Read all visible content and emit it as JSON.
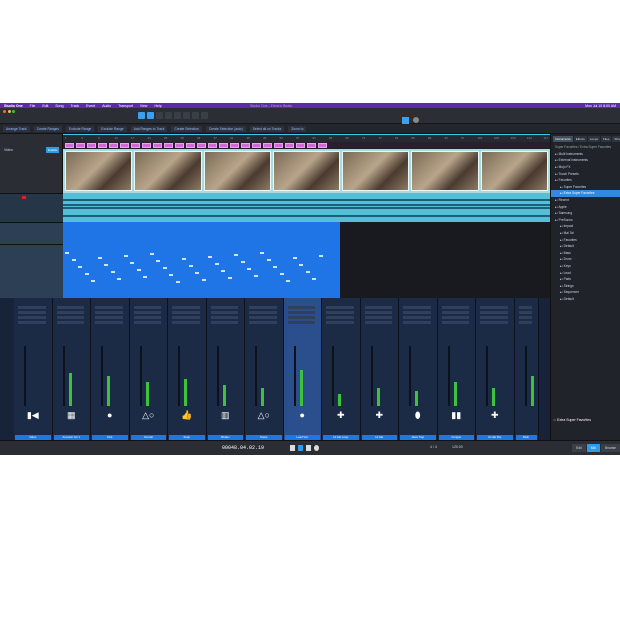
{
  "menubar": {
    "items": [
      "Studio One",
      "File",
      "Edit",
      "Song",
      "Track",
      "Event",
      "Audio",
      "Transport",
      "View",
      "Help"
    ],
    "clock": "Mon Jul 10 8:00 AM"
  },
  "window": {
    "title": "Studio One - Electric Beats"
  },
  "colors": {
    "accent": "#3aa0f0",
    "menubar": "#5a2ca8",
    "marker": "#d36ad3",
    "audio_event": "#55bfd8",
    "instrument_event": "#1f74e6",
    "meter": "#3ec23e"
  },
  "subbar": {
    "buttons": [
      "Arrange Track",
      "Create Ranges",
      "Exclude Range",
      "Exclude Range",
      "Add Ranges to Track",
      "Create Selection",
      "Create Selection (auto)",
      "Select all on Tracks",
      "Zoom to"
    ]
  },
  "track_header": {
    "video_label": "Video",
    "enable": "Enable"
  },
  "ruler": {
    "ticks": [
      "1",
      "5",
      "9",
      "13",
      "17",
      "21",
      "25",
      "29",
      "33",
      "37",
      "41",
      "45",
      "49",
      "53",
      "57",
      "61",
      "65",
      "69",
      "73",
      "77",
      "81",
      "85",
      "89",
      "93",
      "97",
      "101",
      "105",
      "109",
      "113",
      "117"
    ]
  },
  "browser": {
    "tabs": [
      "Instruments",
      "Effects",
      "Loops",
      "Files",
      "Shop"
    ],
    "active_tab": "Instruments",
    "breadcrumb": "Super Favorites / Extra Super Favorites",
    "items": [
      {
        "label": "Multi Instruments"
      },
      {
        "label": "External Instruments"
      },
      {
        "label": "Mojo FX"
      },
      {
        "label": "Touch Presets"
      },
      {
        "label": "Favorites"
      },
      {
        "label": "Super Favorites",
        "indent": true
      },
      {
        "label": "Extra Super Favorites",
        "indent": true,
        "selected": true
      },
      {
        "label": "Recent"
      },
      {
        "label": "Apple"
      },
      {
        "label": "Samsung"
      },
      {
        "label": "PreSonus"
      },
      {
        "label": "Impact",
        "indent": true
      },
      {
        "label": "Mai Tai",
        "indent": true
      },
      {
        "label": "Favorites",
        "indent": true
      },
      {
        "label": "Default",
        "indent": true
      },
      {
        "label": "Bass",
        "indent": true
      },
      {
        "label": "Drum",
        "indent": true
      },
      {
        "label": "Keys",
        "indent": true
      },
      {
        "label": "Lead",
        "indent": true
      },
      {
        "label": "Pads",
        "indent": true
      },
      {
        "label": "Strings",
        "indent": true
      },
      {
        "label": "Sequencer",
        "indent": true
      },
      {
        "label": "Default",
        "indent": true
      }
    ],
    "footer": "Extra Super Favorites"
  },
  "mixer": {
    "channels": [
      {
        "name": "Video",
        "icon": "video-camera-icon",
        "glyph": "▮◀",
        "level": 0
      },
      {
        "name": "Acoustic Gtr 1",
        "icon": "piano-roll-icon",
        "glyph": "▦",
        "level": 0.55
      },
      {
        "name": "Kick",
        "icon": "kick-drum-icon",
        "glyph": "●",
        "level": 0.5
      },
      {
        "name": "Overall",
        "icon": "shapes-icon",
        "glyph": "△○",
        "level": 0.4
      },
      {
        "name": "Snap",
        "icon": "thumbs-up-icon",
        "glyph": "👍",
        "level": 0.45
      },
      {
        "name": "Shaker",
        "icon": "keyboard-icon",
        "glyph": "▥",
        "level": 0.35
      },
      {
        "name": "Snare",
        "icon": "shapes-icon",
        "glyph": "△○",
        "level": 0.3
      },
      {
        "name": "Lead Vox",
        "icon": "microphone-icon",
        "glyph": "●",
        "level": 0.6,
        "selected": true
      },
      {
        "name": "Hi Hat Loop",
        "icon": "cymbal-icon",
        "glyph": "✚",
        "level": 0.2
      },
      {
        "name": "Hi Hat",
        "icon": "cymbal-icon",
        "glyph": "✚",
        "level": 0.3
      },
      {
        "name": "Jaws Trap",
        "icon": "shaker-icon",
        "glyph": "⬮",
        "level": 0.25
      },
      {
        "name": "Congas",
        "icon": "congas-icon",
        "glyph": "▮▮",
        "level": 0.4
      },
      {
        "name": "Hi Hat Flip",
        "icon": "cymbal-icon",
        "glyph": "✚",
        "level": 0.3
      },
      {
        "name": "Main",
        "icon": "",
        "glyph": "",
        "level": 0.5
      }
    ]
  },
  "transport": {
    "timecode": "00048.04.02.19",
    "tempo": "120.00",
    "signature": "4 / 4",
    "views": [
      "Edit",
      "Mix",
      "Browse"
    ],
    "active_view": "Mix"
  }
}
